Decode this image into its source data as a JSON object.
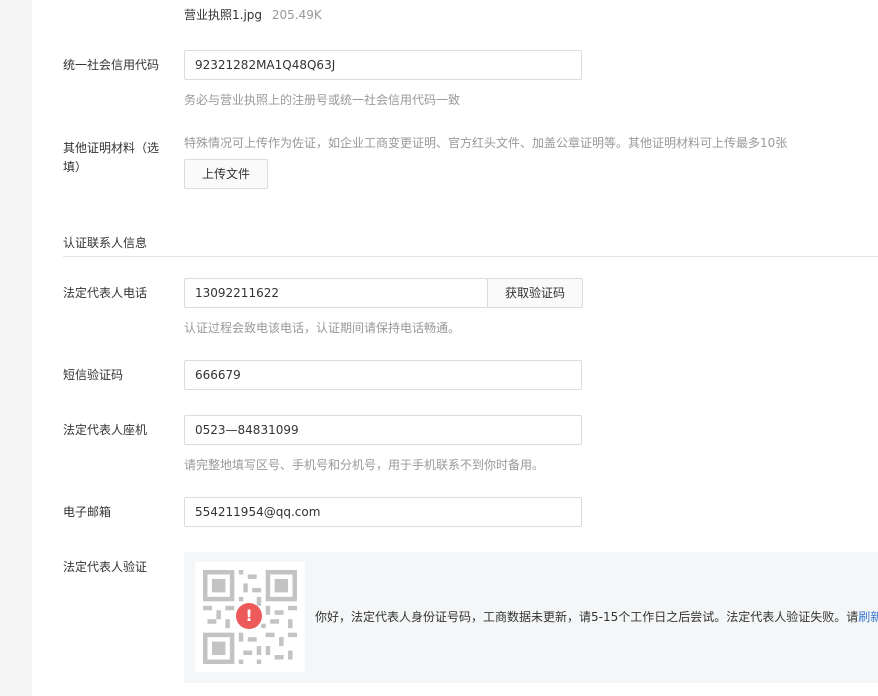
{
  "upload": {
    "filename": "营业执照1.jpg",
    "filesize": "205.49K"
  },
  "credit_code": {
    "label": "统一社会信用代码",
    "value": "92321282MA1Q48Q63J",
    "hint": "务必与营业执照上的注册号或统一社会信用代码一致"
  },
  "other_docs": {
    "label_line1": "其他证明材料（选",
    "label_line2": "填）",
    "hint": "特殊情况可上传作为佐证，如企业工商变更证明、官方红头文件、加盖公章证明等。其他证明材料可上传最多10张",
    "upload_button": "上传文件"
  },
  "contact_section": {
    "title": "认证联系人信息"
  },
  "legal_phone": {
    "label": "法定代表人电话",
    "value": "13092211622",
    "code_button": "获取验证码",
    "hint": "认证过程会致电该电话，认证期间请保持电话畅通。"
  },
  "sms_code": {
    "label": "短信验证码",
    "value": "666679"
  },
  "landline": {
    "label": "法定代表人座机",
    "value": "0523—84831099",
    "hint": "请完整地填写区号、手机号和分机号，用于手机联系不到你时备用。"
  },
  "email": {
    "label": "电子邮箱",
    "value": "554211954@qq.com"
  },
  "legal_verify": {
    "label": "法定代表人验证",
    "alert_glyph": "!",
    "message": "你好，法定代表人身份证号码，工商数据未更新，请5-15个工作日之后尝试。法定代表人验证失败。请",
    "refresh_link": "刷新"
  },
  "colors": {
    "accent_link": "#3a78d1",
    "error_red": "#ec5a5a",
    "hint_gray": "#999999"
  }
}
